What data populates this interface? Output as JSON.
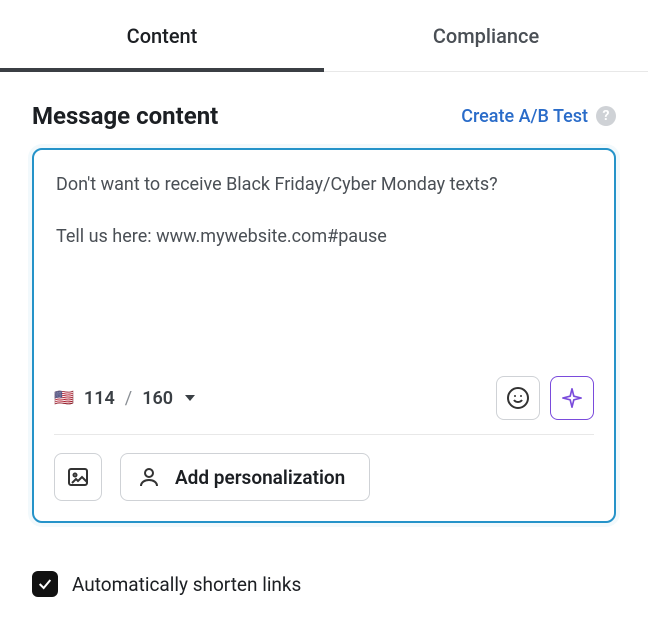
{
  "tabs": {
    "content": "Content",
    "compliance": "Compliance"
  },
  "header": {
    "title": "Message content",
    "ab_link": "Create A/B Test"
  },
  "message": {
    "text": "Don't want to receive Black Friday/Cyber Monday texts?\n\nTell us here: www.mywebsite.com#pause"
  },
  "counter": {
    "flag": "🇺🇸",
    "current": "114",
    "sep": "/",
    "max": "160"
  },
  "actions": {
    "personalize": "Add personalization"
  },
  "shorten": {
    "label": "Automatically shorten links",
    "checked": true
  }
}
